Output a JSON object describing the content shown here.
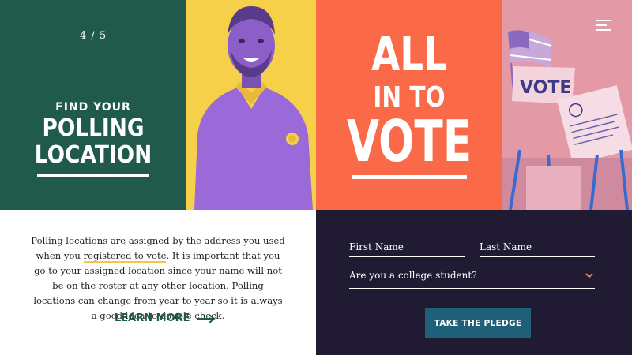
{
  "slide": {
    "counter": "4 / 5",
    "kicker": "FIND YOUR",
    "title_line1": "POLLING",
    "title_line2": "LOCATION"
  },
  "hero": {
    "line1": "ALL",
    "line2": "IN TO",
    "line3": "VOTE"
  },
  "photo_sign": "VOTE",
  "info": {
    "para_before": "Polling locations are assigned by the address you used when you ",
    "para_link": "registered to vote",
    "para_after": ". It is important that you go to your assigned location since your name will not be on the roster at any other location. Polling locations can change from year to year so it is always a good idea to double check.",
    "learn_more": "LEARN MORE"
  },
  "form": {
    "first_name_placeholder": "First Name",
    "last_name_placeholder": "Last Name",
    "college_question": "Are you a college student?",
    "pledge_button": "TAKE THE PLEDGE"
  },
  "colors": {
    "green": "#1f5a4a",
    "yellow": "#f7d04a",
    "orange": "#fa6a48",
    "pink": "#e49aa6",
    "purple": "#9b6ad8",
    "navy": "#201b33",
    "button": "#1e6078",
    "chevron": "#f07a56"
  },
  "icons": {
    "menu": "hamburger-menu-icon",
    "arrow": "arrow-right-icon",
    "chevron": "chevron-down-icon"
  }
}
